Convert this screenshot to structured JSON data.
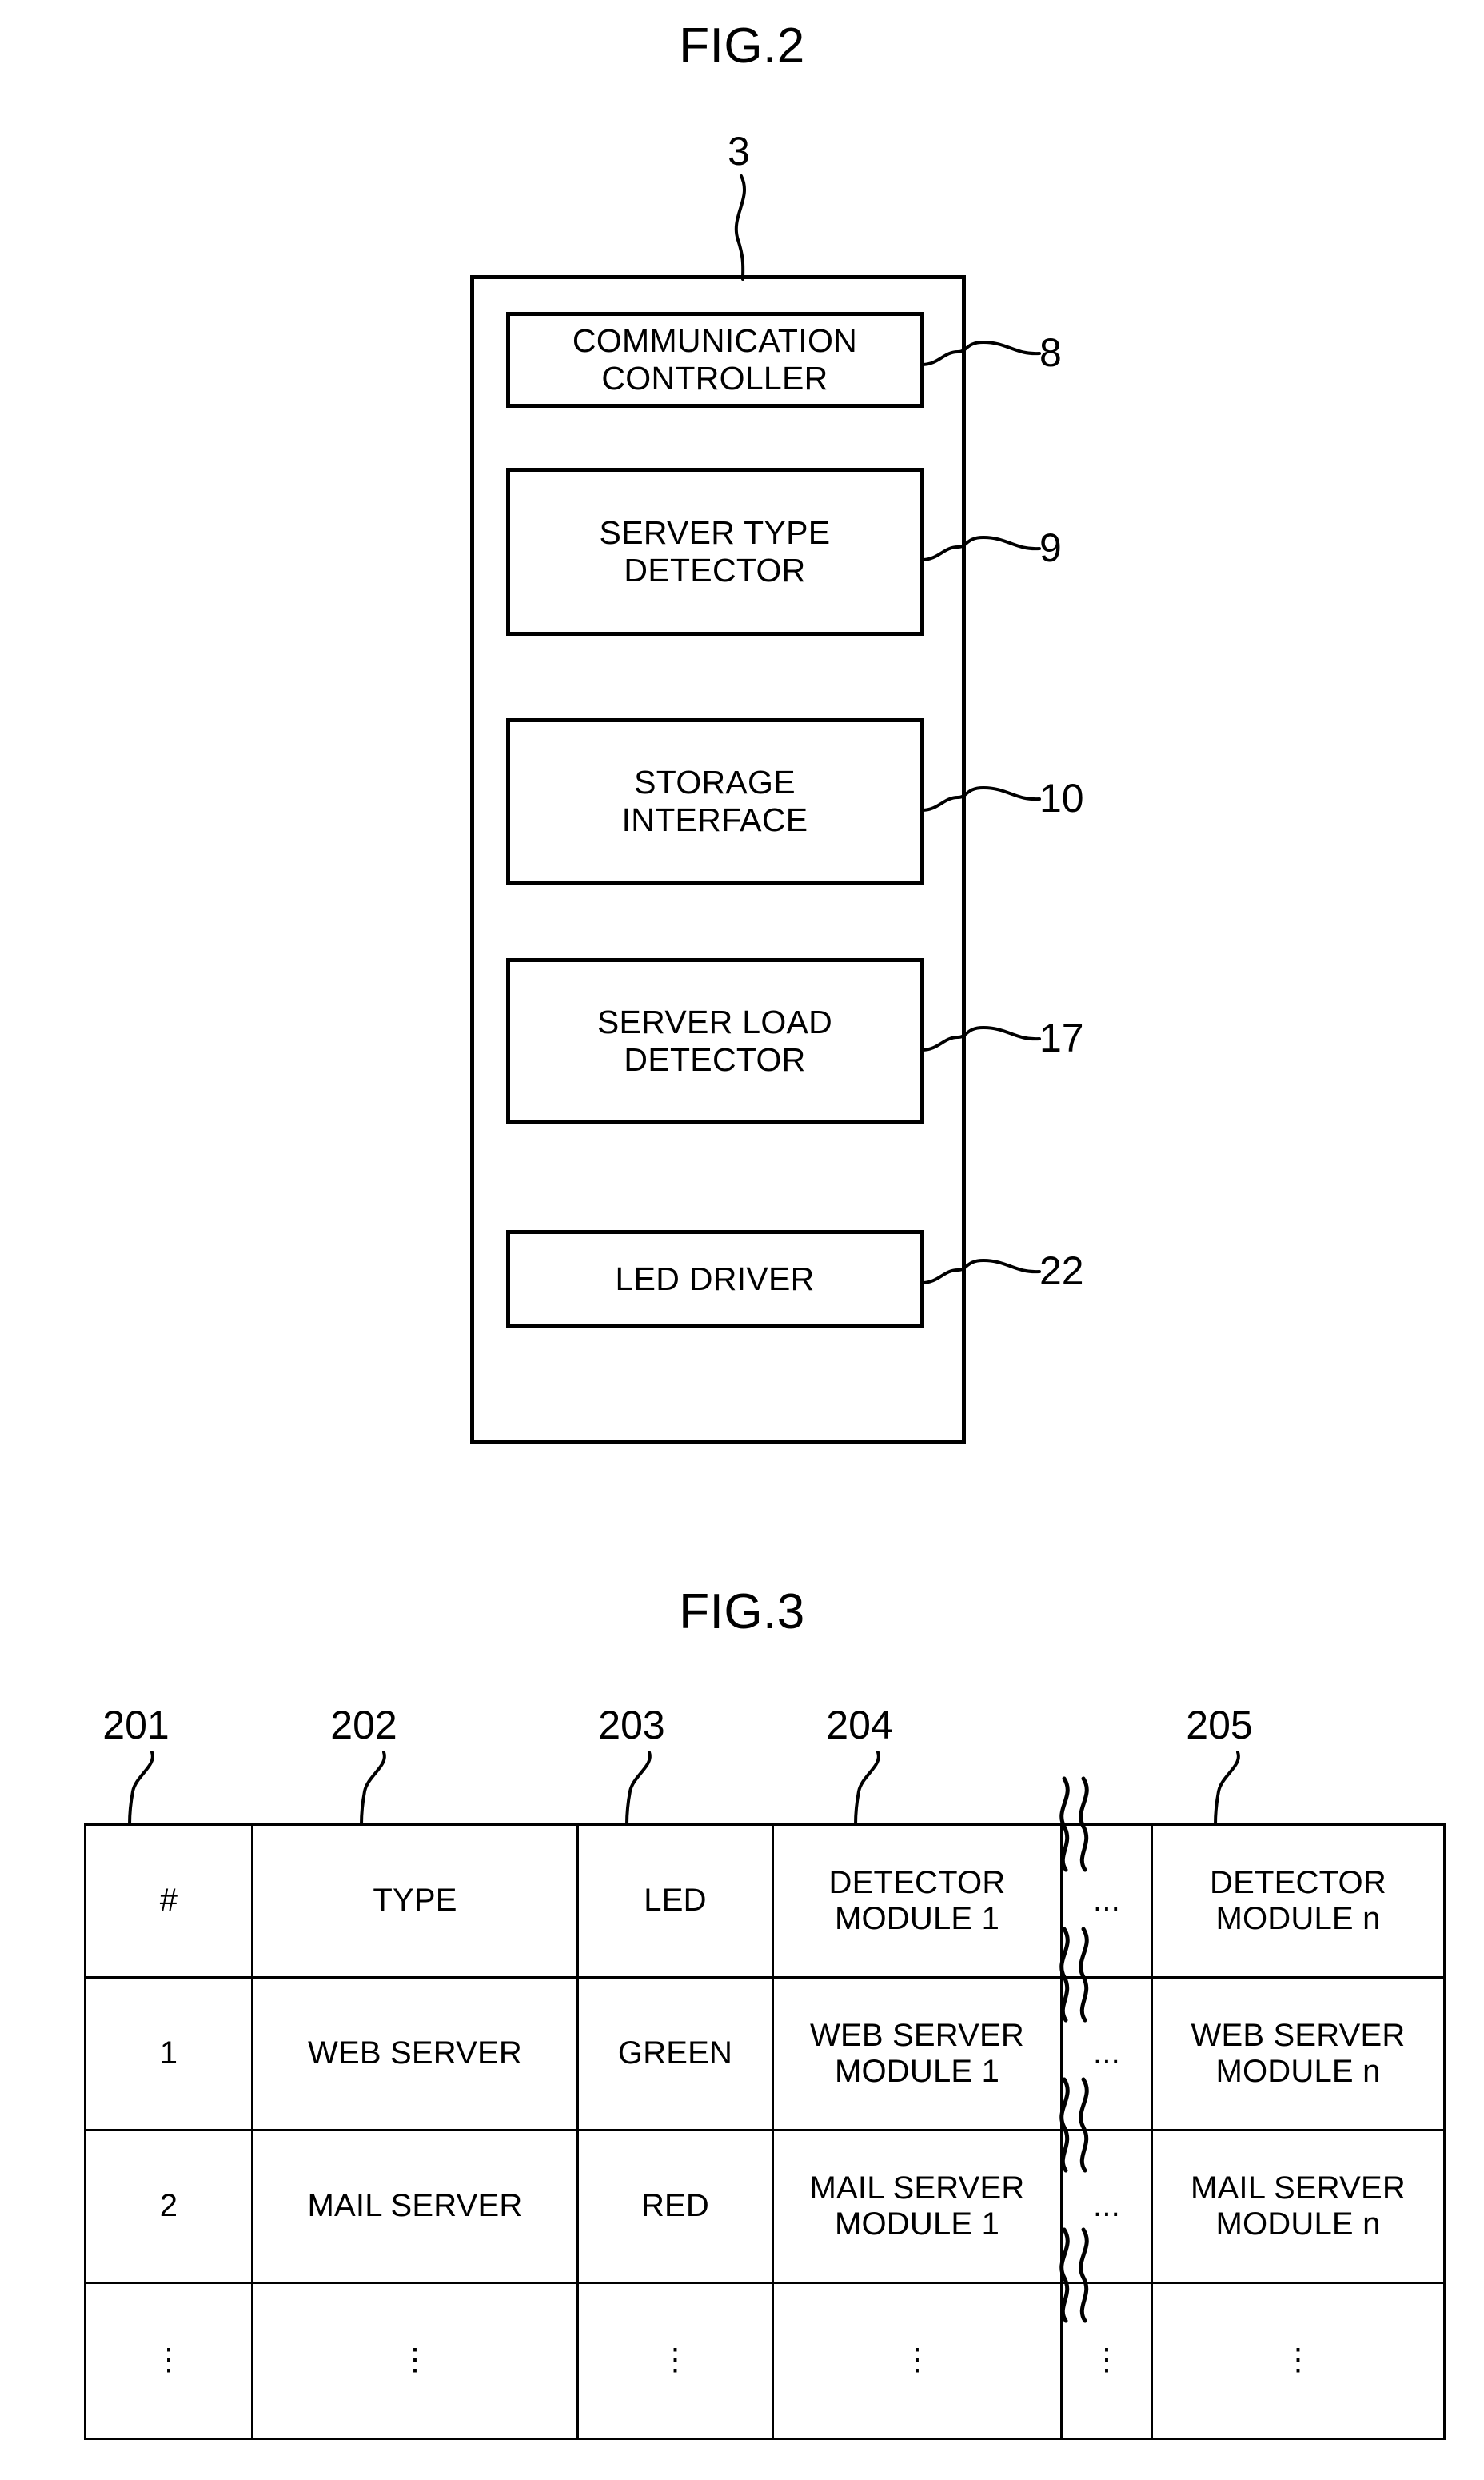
{
  "figures": {
    "fig2": {
      "title": "FIG.2",
      "outer_ref": "3",
      "blocks": [
        {
          "label": "COMMUNICATION\nCONTROLLER",
          "line1": "COMMUNICATION",
          "line2": "CONTROLLER",
          "ref": "8"
        },
        {
          "label": "SERVER TYPE\nDETECTOR",
          "line1": "SERVER TYPE",
          "line2": "DETECTOR",
          "ref": "9"
        },
        {
          "label": "STORAGE\nINTERFACE",
          "line1": "STORAGE",
          "line2": "INTERFACE",
          "ref": "10"
        },
        {
          "label": "SERVER LOAD\nDETECTOR",
          "line1": "SERVER LOAD",
          "line2": "DETECTOR",
          "ref": "17"
        },
        {
          "label": "LED DRIVER",
          "line1": "LED DRIVER",
          "line2": "",
          "ref": "22"
        }
      ]
    },
    "fig3": {
      "title": "FIG.3",
      "column_refs": [
        "201",
        "202",
        "203",
        "204",
        "205"
      ],
      "table": {
        "header": {
          "num": "#",
          "type": "TYPE",
          "led": "LED",
          "module1_line1": "DETECTOR",
          "module1_line2": "MODULE 1",
          "dots": "...",
          "modulen_line1": "DETECTOR",
          "modulen_line2": "MODULE n"
        },
        "rows": [
          {
            "num": "1",
            "type": "WEB SERVER",
            "led": "GREEN",
            "module1_line1": "WEB SERVER",
            "module1_line2": "MODULE 1",
            "dots": "...",
            "modulen_line1": "WEB SERVER",
            "modulen_line2": "MODULE n"
          },
          {
            "num": "2",
            "type": "MAIL SERVER",
            "led": "RED",
            "module1_line1": "MAIL SERVER",
            "module1_line2": "MODULE 1",
            "dots": "...",
            "modulen_line1": "MAIL SERVER",
            "modulen_line2": "MODULE n"
          }
        ],
        "continuation_row": {
          "num": "⋮",
          "type": "⋮",
          "led": "⋮",
          "module1": "⋮",
          "dots": "⋮",
          "modulen": "⋮"
        }
      }
    }
  },
  "style": {
    "ink": "#000000",
    "paper": "#ffffff"
  }
}
